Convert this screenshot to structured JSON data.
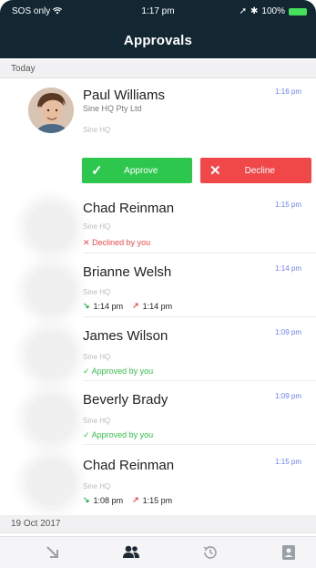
{
  "status_bar": {
    "carrier": "SOS only",
    "time": "1:17 pm",
    "battery": "100%"
  },
  "header": {
    "title": "Approvals"
  },
  "sections": [
    {
      "label": "Today"
    },
    {
      "label": "19 Oct 2017"
    }
  ],
  "approvals": [
    {
      "name": "Paul Williams",
      "company": "Sine HQ Pty Ltd",
      "location": "Sine HQ",
      "time": "1:16 pm",
      "actions": {
        "approve_label": "Approve",
        "decline_label": "Decline"
      }
    },
    {
      "name": "Chad Reinman",
      "location": "Sine HQ",
      "time": "1:15 pm",
      "status": "Declined by you"
    },
    {
      "name": "Brianne Welsh",
      "location": "Sine HQ",
      "time": "1:14 pm",
      "in_time": "1:14 pm",
      "out_time": "1:14 pm"
    },
    {
      "name": "James Wilson",
      "location": "Sine HQ",
      "time": "1:09 pm",
      "status": "Approved by you"
    },
    {
      "name": "Beverly Brady",
      "location": "Sine HQ",
      "time": "1:09 pm",
      "status": "Approved by you"
    },
    {
      "name": "Chad Reinman",
      "location": "Sine HQ",
      "time": "1:15 pm",
      "in_time": "1:08 pm",
      "out_time": "1:15 pm"
    }
  ],
  "tabbar": {
    "items": [
      "sign-in",
      "approvals",
      "timesheets",
      "profile"
    ]
  },
  "colors": {
    "header_bg": "#132733",
    "approve": "#2ec74e",
    "decline": "#f04848",
    "time_blue": "#6b7cff"
  }
}
